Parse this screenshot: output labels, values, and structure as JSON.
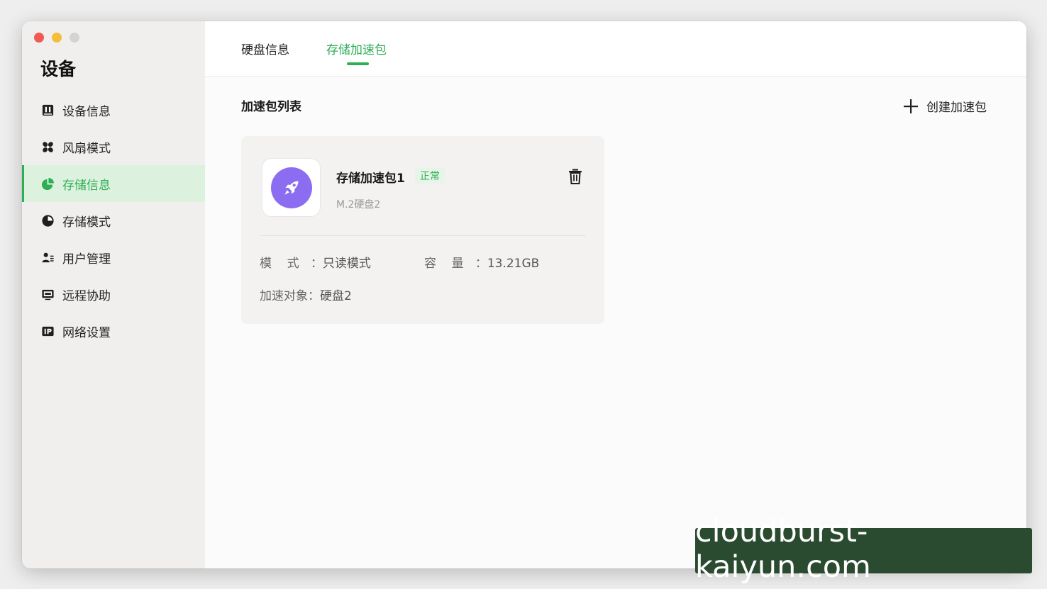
{
  "window": {
    "traffic_lights": [
      "close",
      "minimize",
      "zoom"
    ]
  },
  "sidebar": {
    "title": "设备",
    "items": [
      {
        "label": "设备信息",
        "icon": "device-info-icon",
        "active": false
      },
      {
        "label": "风扇模式",
        "icon": "fan-icon",
        "active": false
      },
      {
        "label": "存储信息",
        "icon": "storage-pie-icon",
        "active": true
      },
      {
        "label": "存储模式",
        "icon": "pie-chart-icon",
        "active": false
      },
      {
        "label": "用户管理",
        "icon": "users-icon",
        "active": false
      },
      {
        "label": "远程协助",
        "icon": "monitor-icon",
        "active": false
      },
      {
        "label": "网络设置",
        "icon": "ip-icon",
        "active": false
      }
    ]
  },
  "tabs": [
    {
      "label": "硬盘信息",
      "active": false
    },
    {
      "label": "存储加速包",
      "active": true
    }
  ],
  "main": {
    "section_title": "加速包列表",
    "create_label": "创建加速包",
    "card": {
      "name": "存储加速包1",
      "status": "正常",
      "subtitle": "M.2硬盘2",
      "mode_label": "模    式   ：",
      "mode_value": "只读模式",
      "capacity_label": "容    量   ：",
      "capacity_value": "13.21GB",
      "target_label": "加速对象：",
      "target_value": "硬盘2"
    }
  },
  "watermark": "cloudburst-kaiyun.com",
  "colors": {
    "accent": "#2fae55",
    "sidebar_bg": "#f1efee",
    "active_bg": "#dcf2df",
    "rocket": "#8c6df2"
  }
}
